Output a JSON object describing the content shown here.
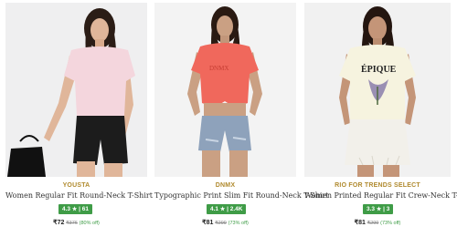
{
  "products": [
    {
      "brand": "YOUSTA",
      "title": "Women Regular Fit Round-Neck T-Shirt",
      "rating": "4.3",
      "reviews": "61",
      "price": "₹72",
      "mrp": "₹376",
      "discount": "(80% off)",
      "image": "woman-pink-tshirt-black-shorts-photo",
      "colors": {
        "top": "#f4d6dd",
        "bottom": "#1c1c1c",
        "bg": "#efeff0"
      }
    },
    {
      "brand": "DNMX",
      "title": "Typographic Print Slim Fit Round-Neck T-Shirt",
      "rating": "4.1",
      "reviews": "2.4K",
      "price": "₹81",
      "mrp": "₹299",
      "discount": "(73% off)",
      "image": "woman-coral-crop-tshirt-denim-shorts-photo",
      "colors": {
        "top": "#f0685c",
        "bottom": "#8ea2bb",
        "bg": "#f3f3f3"
      }
    },
    {
      "brand": "RIO FOR TRENDS SELECT",
      "title": "Women Printed Regular Fit Crew-Neck T-Shirt",
      "rating": "3.3",
      "reviews": "3",
      "price": "₹81",
      "mrp": "₹299",
      "discount": "(73% off)",
      "image": "woman-cream-printed-tshirt-white-skirt-photo",
      "colors": {
        "top": "#f6f3df",
        "bottom": "#f2f0ea",
        "bg": "#f1f1f1"
      }
    }
  ],
  "ui": {
    "star_icon": "star-icon",
    "accent_green": "#3f9c47",
    "brand_gold": "#b08a2e"
  }
}
